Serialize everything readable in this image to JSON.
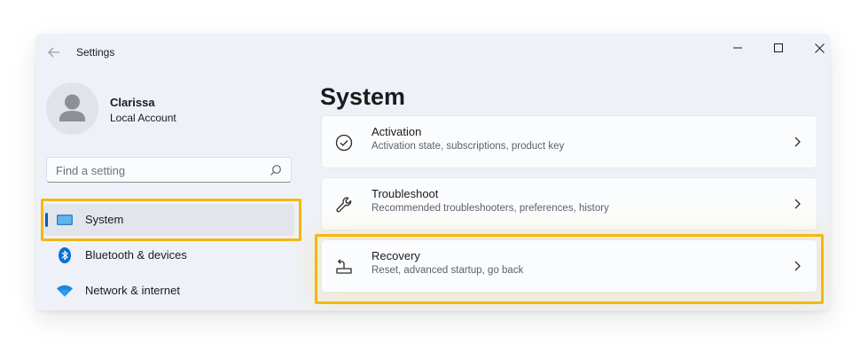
{
  "window": {
    "title": "Settings"
  },
  "user": {
    "name": "Clarissa",
    "account_type": "Local Account"
  },
  "search": {
    "placeholder": "Find a setting"
  },
  "sidebar": {
    "items": [
      {
        "label": "System",
        "icon": "laptop-icon",
        "selected": true
      },
      {
        "label": "Bluetooth & devices",
        "icon": "bluetooth-icon",
        "selected": false
      },
      {
        "label": "Network & internet",
        "icon": "wifi-icon",
        "selected": false
      }
    ]
  },
  "main": {
    "title": "System",
    "cards": [
      {
        "title": "Activation",
        "description": "Activation state, subscriptions, product key",
        "icon": "check-circle-icon"
      },
      {
        "title": "Troubleshoot",
        "description": "Recommended troubleshooters, preferences, history",
        "icon": "wrench-icon"
      },
      {
        "title": "Recovery",
        "description": "Reset, advanced startup, go back",
        "icon": "recovery-icon"
      }
    ]
  },
  "colors": {
    "accent": "#005fb8",
    "highlight": "#f5b70f",
    "window_bg": "#eef2f8"
  }
}
